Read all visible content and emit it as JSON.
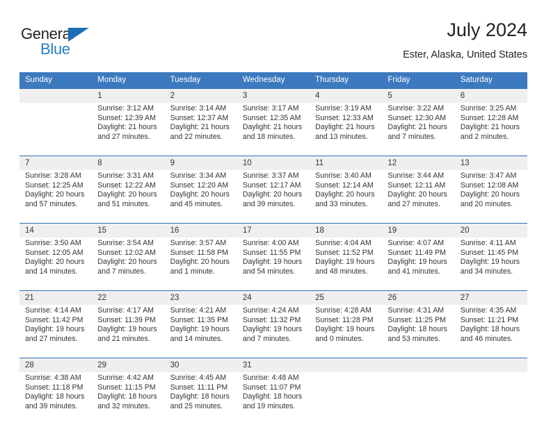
{
  "brand": {
    "name_top": "General",
    "name_bottom": "Blue",
    "accent_color": "#2a7fc4",
    "triangle_color": "#1c6fb5"
  },
  "header": {
    "title": "July 2024",
    "subtitle": "Ester, Alaska, United States"
  },
  "theme": {
    "header_blue": "#3d79bf",
    "row_border_blue": "#2c6fb2",
    "daynum_band": "#efefef",
    "text": "#333333"
  },
  "calendar": {
    "weekday_headers": [
      "Sunday",
      "Monday",
      "Tuesday",
      "Wednesday",
      "Thursday",
      "Friday",
      "Saturday"
    ],
    "labels": {
      "sunrise": "Sunrise:",
      "sunset": "Sunset:",
      "daylight": "Daylight:"
    },
    "weeks": [
      [
        {
          "day": "",
          "sunrise": "",
          "sunset": "",
          "daylight_1": "",
          "daylight_2": ""
        },
        {
          "day": "1",
          "sunrise": "Sunrise: 3:12 AM",
          "sunset": "Sunset: 12:39 AM",
          "daylight_1": "Daylight: 21 hours",
          "daylight_2": "and 27 minutes."
        },
        {
          "day": "2",
          "sunrise": "Sunrise: 3:14 AM",
          "sunset": "Sunset: 12:37 AM",
          "daylight_1": "Daylight: 21 hours",
          "daylight_2": "and 22 minutes."
        },
        {
          "day": "3",
          "sunrise": "Sunrise: 3:17 AM",
          "sunset": "Sunset: 12:35 AM",
          "daylight_1": "Daylight: 21 hours",
          "daylight_2": "and 18 minutes."
        },
        {
          "day": "4",
          "sunrise": "Sunrise: 3:19 AM",
          "sunset": "Sunset: 12:33 AM",
          "daylight_1": "Daylight: 21 hours",
          "daylight_2": "and 13 minutes."
        },
        {
          "day": "5",
          "sunrise": "Sunrise: 3:22 AM",
          "sunset": "Sunset: 12:30 AM",
          "daylight_1": "Daylight: 21 hours",
          "daylight_2": "and 7 minutes."
        },
        {
          "day": "6",
          "sunrise": "Sunrise: 3:25 AM",
          "sunset": "Sunset: 12:28 AM",
          "daylight_1": "Daylight: 21 hours",
          "daylight_2": "and 2 minutes."
        }
      ],
      [
        {
          "day": "7",
          "sunrise": "Sunrise: 3:28 AM",
          "sunset": "Sunset: 12:25 AM",
          "daylight_1": "Daylight: 20 hours",
          "daylight_2": "and 57 minutes."
        },
        {
          "day": "8",
          "sunrise": "Sunrise: 3:31 AM",
          "sunset": "Sunset: 12:22 AM",
          "daylight_1": "Daylight: 20 hours",
          "daylight_2": "and 51 minutes."
        },
        {
          "day": "9",
          "sunrise": "Sunrise: 3:34 AM",
          "sunset": "Sunset: 12:20 AM",
          "daylight_1": "Daylight: 20 hours",
          "daylight_2": "and 45 minutes."
        },
        {
          "day": "10",
          "sunrise": "Sunrise: 3:37 AM",
          "sunset": "Sunset: 12:17 AM",
          "daylight_1": "Daylight: 20 hours",
          "daylight_2": "and 39 minutes."
        },
        {
          "day": "11",
          "sunrise": "Sunrise: 3:40 AM",
          "sunset": "Sunset: 12:14 AM",
          "daylight_1": "Daylight: 20 hours",
          "daylight_2": "and 33 minutes."
        },
        {
          "day": "12",
          "sunrise": "Sunrise: 3:44 AM",
          "sunset": "Sunset: 12:11 AM",
          "daylight_1": "Daylight: 20 hours",
          "daylight_2": "and 27 minutes."
        },
        {
          "day": "13",
          "sunrise": "Sunrise: 3:47 AM",
          "sunset": "Sunset: 12:08 AM",
          "daylight_1": "Daylight: 20 hours",
          "daylight_2": "and 20 minutes."
        }
      ],
      [
        {
          "day": "14",
          "sunrise": "Sunrise: 3:50 AM",
          "sunset": "Sunset: 12:05 AM",
          "daylight_1": "Daylight: 20 hours",
          "daylight_2": "and 14 minutes."
        },
        {
          "day": "15",
          "sunrise": "Sunrise: 3:54 AM",
          "sunset": "Sunset: 12:02 AM",
          "daylight_1": "Daylight: 20 hours",
          "daylight_2": "and 7 minutes."
        },
        {
          "day": "16",
          "sunrise": "Sunrise: 3:57 AM",
          "sunset": "Sunset: 11:58 PM",
          "daylight_1": "Daylight: 20 hours",
          "daylight_2": "and 1 minute."
        },
        {
          "day": "17",
          "sunrise": "Sunrise: 4:00 AM",
          "sunset": "Sunset: 11:55 PM",
          "daylight_1": "Daylight: 19 hours",
          "daylight_2": "and 54 minutes."
        },
        {
          "day": "18",
          "sunrise": "Sunrise: 4:04 AM",
          "sunset": "Sunset: 11:52 PM",
          "daylight_1": "Daylight: 19 hours",
          "daylight_2": "and 48 minutes."
        },
        {
          "day": "19",
          "sunrise": "Sunrise: 4:07 AM",
          "sunset": "Sunset: 11:49 PM",
          "daylight_1": "Daylight: 19 hours",
          "daylight_2": "and 41 minutes."
        },
        {
          "day": "20",
          "sunrise": "Sunrise: 4:11 AM",
          "sunset": "Sunset: 11:45 PM",
          "daylight_1": "Daylight: 19 hours",
          "daylight_2": "and 34 minutes."
        }
      ],
      [
        {
          "day": "21",
          "sunrise": "Sunrise: 4:14 AM",
          "sunset": "Sunset: 11:42 PM",
          "daylight_1": "Daylight: 19 hours",
          "daylight_2": "and 27 minutes."
        },
        {
          "day": "22",
          "sunrise": "Sunrise: 4:17 AM",
          "sunset": "Sunset: 11:39 PM",
          "daylight_1": "Daylight: 19 hours",
          "daylight_2": "and 21 minutes."
        },
        {
          "day": "23",
          "sunrise": "Sunrise: 4:21 AM",
          "sunset": "Sunset: 11:35 PM",
          "daylight_1": "Daylight: 19 hours",
          "daylight_2": "and 14 minutes."
        },
        {
          "day": "24",
          "sunrise": "Sunrise: 4:24 AM",
          "sunset": "Sunset: 11:32 PM",
          "daylight_1": "Daylight: 19 hours",
          "daylight_2": "and 7 minutes."
        },
        {
          "day": "25",
          "sunrise": "Sunrise: 4:28 AM",
          "sunset": "Sunset: 11:28 PM",
          "daylight_1": "Daylight: 19 hours",
          "daylight_2": "and 0 minutes."
        },
        {
          "day": "26",
          "sunrise": "Sunrise: 4:31 AM",
          "sunset": "Sunset: 11:25 PM",
          "daylight_1": "Daylight: 18 hours",
          "daylight_2": "and 53 minutes."
        },
        {
          "day": "27",
          "sunrise": "Sunrise: 4:35 AM",
          "sunset": "Sunset: 11:21 PM",
          "daylight_1": "Daylight: 18 hours",
          "daylight_2": "and 46 minutes."
        }
      ],
      [
        {
          "day": "28",
          "sunrise": "Sunrise: 4:38 AM",
          "sunset": "Sunset: 11:18 PM",
          "daylight_1": "Daylight: 18 hours",
          "daylight_2": "and 39 minutes."
        },
        {
          "day": "29",
          "sunrise": "Sunrise: 4:42 AM",
          "sunset": "Sunset: 11:15 PM",
          "daylight_1": "Daylight: 18 hours",
          "daylight_2": "and 32 minutes."
        },
        {
          "day": "30",
          "sunrise": "Sunrise: 4:45 AM",
          "sunset": "Sunset: 11:11 PM",
          "daylight_1": "Daylight: 18 hours",
          "daylight_2": "and 25 minutes."
        },
        {
          "day": "31",
          "sunrise": "Sunrise: 4:48 AM",
          "sunset": "Sunset: 11:07 PM",
          "daylight_1": "Daylight: 18 hours",
          "daylight_2": "and 19 minutes."
        },
        {
          "day": "",
          "sunrise": "",
          "sunset": "",
          "daylight_1": "",
          "daylight_2": ""
        },
        {
          "day": "",
          "sunrise": "",
          "sunset": "",
          "daylight_1": "",
          "daylight_2": ""
        },
        {
          "day": "",
          "sunrise": "",
          "sunset": "",
          "daylight_1": "",
          "daylight_2": ""
        }
      ]
    ]
  }
}
